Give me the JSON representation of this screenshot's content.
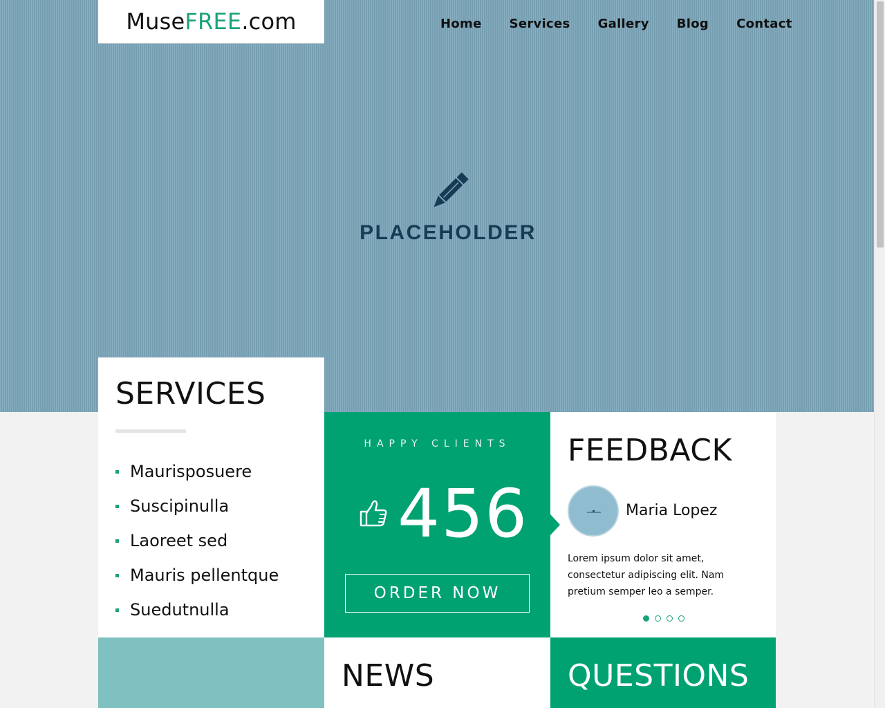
{
  "logo": {
    "prefix": "Muse",
    "accent": "FREE",
    "suffix": ".com"
  },
  "nav": {
    "items": [
      "Home",
      "Services",
      "Gallery",
      "Blog",
      "Contact"
    ]
  },
  "hero": {
    "placeholder_text": "PLACEHOLDER",
    "icon": "pencil-icon"
  },
  "services": {
    "title": "SERVICES",
    "items": [
      "Maurisposuere",
      "Suscipinulla",
      "Laoreet sed",
      "Mauris pellentque",
      "Suedutnulla"
    ]
  },
  "happy_clients": {
    "label": "HAPPY CLIENTS",
    "count": "456",
    "icon": "thumbs-up-icon",
    "button_label": "ORDER NOW"
  },
  "feedback": {
    "title": "FEEDBACK",
    "name": "Maria Lopez",
    "quote": "Lorem ipsum dolor sit amet, consectetur adipiscing elit. Nam pretium semper leo a semper.",
    "slides": 4,
    "active_slide": 1
  },
  "news": {
    "title": "NEWS"
  },
  "questions": {
    "title": "QUESTIONS"
  },
  "colors": {
    "accent": "#00a272",
    "hero_bg": "#7ea7ba",
    "teal_block": "#7fc1c0"
  }
}
